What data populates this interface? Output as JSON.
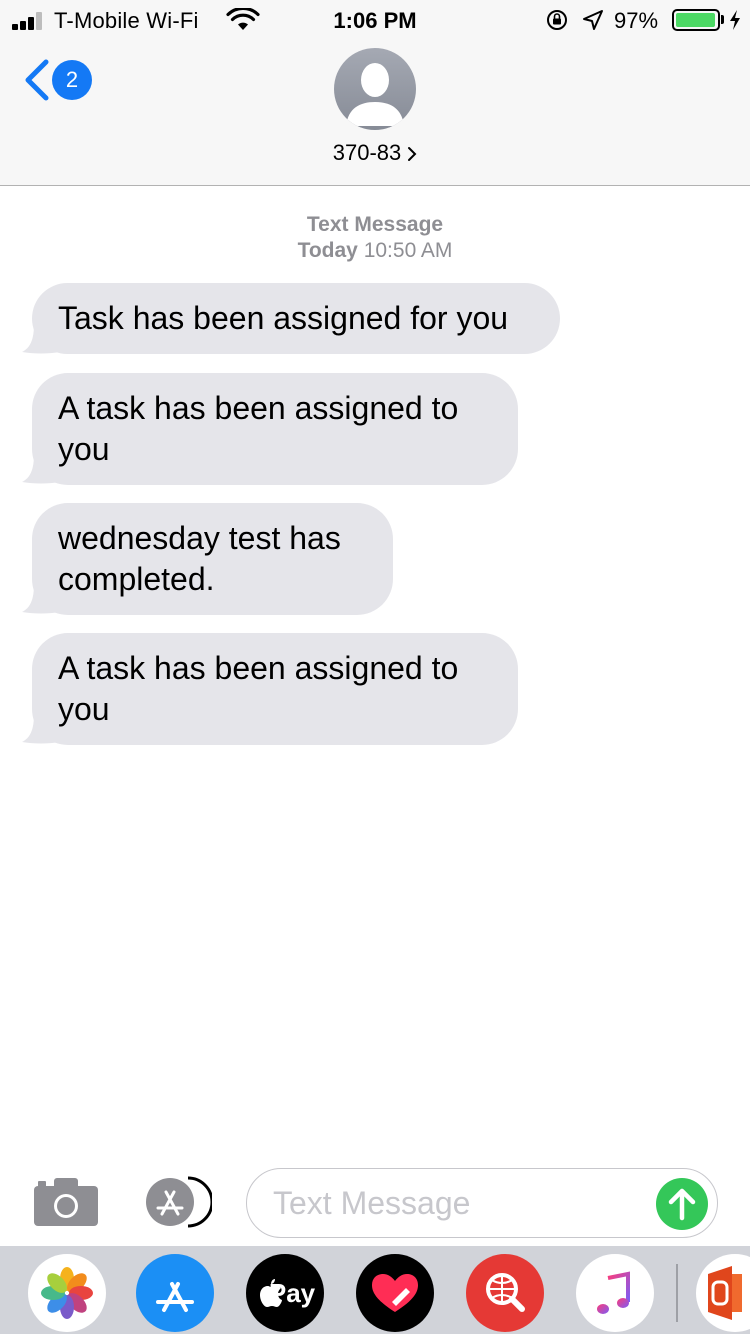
{
  "status_bar": {
    "carrier": "T-Mobile Wi-Fi",
    "time": "1:06 PM",
    "battery_percent": "97%",
    "battery_level": 0.97,
    "icons": [
      "signal-icon",
      "wifi-icon",
      "orientation-lock-icon",
      "location-icon",
      "battery-icon",
      "charging-bolt-icon"
    ]
  },
  "header": {
    "back_badge_count": "2",
    "contact_name": "370-83",
    "icons": [
      "back-chevron-icon",
      "contact-avatar-icon",
      "chevron-right-icon"
    ]
  },
  "thread": {
    "service_label": "Text Message",
    "day": "Today",
    "time": "10:50 AM",
    "messages": [
      {
        "text": "Task has been assigned for you",
        "direction": "incoming"
      },
      {
        "text": "A task has been assigned to you",
        "direction": "incoming"
      },
      {
        "text": "wednesday test has completed.",
        "direction": "incoming"
      },
      {
        "text": "A task has been assigned to you",
        "direction": "incoming"
      }
    ]
  },
  "compose": {
    "placeholder": "Text Message",
    "icons": [
      "camera-icon",
      "app-store-icon",
      "send-arrow-icon"
    ]
  },
  "app_drawer": {
    "apple_pay_label": "Pay",
    "apps": [
      "photos-app-icon",
      "app-store-app-icon",
      "apple-pay-app-icon",
      "digital-touch-app-icon",
      "search-images-app-icon",
      "music-app-icon",
      "office-app-icon"
    ]
  },
  "colors": {
    "ios_blue": "#1479f5",
    "bubble_gray": "#e5e5ea",
    "send_green": "#34c759",
    "battery_green": "#4cd964",
    "secondary_text": "#8e8e93"
  }
}
